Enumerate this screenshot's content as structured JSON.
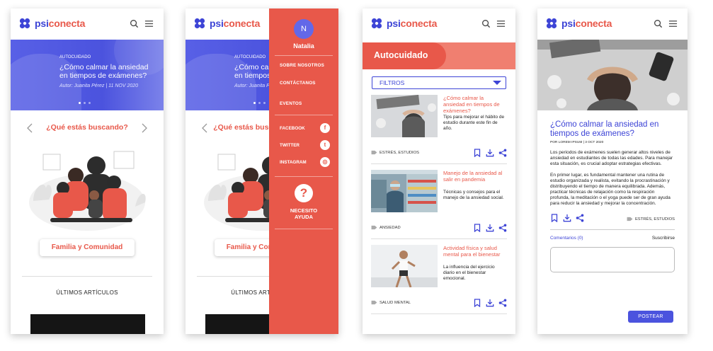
{
  "brand": {
    "prefix": "psi",
    "suffix": "conecta"
  },
  "colors": {
    "primary": "#3d44d6",
    "accent": "#e8584a"
  },
  "home": {
    "hero": {
      "category": "AUTOCUIDADO",
      "title": "¿Cómo calmar la ansiedad en tiempos de exámenes?",
      "author": "Autor: Juanita Pérez | 11 NOV 2020"
    },
    "search_prompt": "¿Qué estás buscando?",
    "category_button": "Familia y Comunidad",
    "latest_title": "ÚLTIMOS ARTÍCULOS"
  },
  "menu": {
    "avatar_initial": "N",
    "user_name": "Natalia",
    "items": [
      "SOBRE NOSOTROS",
      "CONTÁCTANOS",
      "EVENTOS"
    ],
    "social": [
      {
        "label": "FACEBOOK",
        "icon": "facebook-icon",
        "glyph": "f"
      },
      {
        "label": "TWITTER",
        "icon": "twitter-icon",
        "glyph": "t"
      },
      {
        "label": "INSTAGRAM",
        "icon": "instagram-icon",
        "glyph": "◎"
      }
    ],
    "help_glyph": "?",
    "help_label": "NECESITO AYUDA"
  },
  "list": {
    "section_title": "Autocuidado",
    "filter_label": "FILTROS",
    "articles": [
      {
        "title": "¿Cómo calmar la ansiedad en tiempos de exámenes?",
        "desc": "Tips para mejorar el hábito de estudio durante este fin de año.",
        "tags": "ESTRÉS, ESTUDIOS"
      },
      {
        "title": "Manejo de la ansiedad al salir en pandemia",
        "desc": "Técnicas y consejos para el manejo de la ansiedad social.",
        "tags": "ANSIEDAD"
      },
      {
        "title": "Actividad física y salud mental para el bienestar",
        "desc": "La influencia del ejercicio diario en el bienestar emocional.",
        "tags": "SALUD MENTAL"
      }
    ]
  },
  "article": {
    "title": "¿Cómo calmar la ansiedad en tiempos de exámenes?",
    "byline": "POR LOREM IPSUM | 3 OCT 2020",
    "paragraph1": "Los periodos de exámenes suelen generar altos niveles de ansiedad en estudiantes de todas las edades. Para manejar esta situación, es crucial adoptar estrategias efectivas.",
    "paragraph2": "En primer lugar, es fundamental mantener una rutina de estudio organizada y realista, evitando la procrastinación y distribuyendo el tiempo de manera equilibrada. Además, practicar técnicas de relajación como la respiración profunda, la meditación o el yoga puede ser de gran ayuda para reducir la ansiedad y mejorar la concentración.",
    "tags": "ESTRÉS, ESTUDIOS",
    "comments_label": "Comentarios (0)",
    "subscribe_label": "Suscribirse",
    "post_label": "POSTEAR"
  }
}
